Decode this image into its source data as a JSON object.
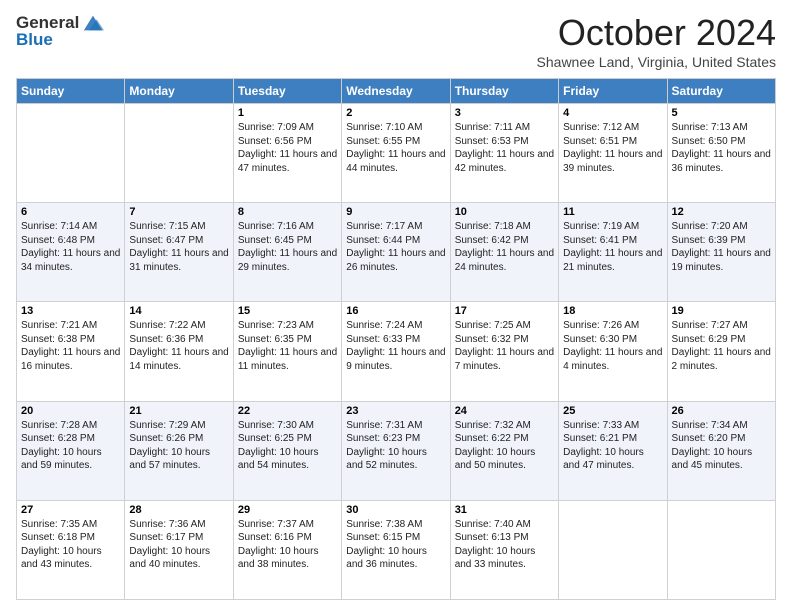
{
  "header": {
    "logo_general": "General",
    "logo_blue": "Blue",
    "month_title": "October 2024",
    "location": "Shawnee Land, Virginia, United States"
  },
  "days_of_week": [
    "Sunday",
    "Monday",
    "Tuesday",
    "Wednesday",
    "Thursday",
    "Friday",
    "Saturday"
  ],
  "weeks": [
    [
      {
        "day": "",
        "sunrise": "",
        "sunset": "",
        "daylight": ""
      },
      {
        "day": "",
        "sunrise": "",
        "sunset": "",
        "daylight": ""
      },
      {
        "day": "1",
        "sunrise": "Sunrise: 7:09 AM",
        "sunset": "Sunset: 6:56 PM",
        "daylight": "Daylight: 11 hours and 47 minutes."
      },
      {
        "day": "2",
        "sunrise": "Sunrise: 7:10 AM",
        "sunset": "Sunset: 6:55 PM",
        "daylight": "Daylight: 11 hours and 44 minutes."
      },
      {
        "day": "3",
        "sunrise": "Sunrise: 7:11 AM",
        "sunset": "Sunset: 6:53 PM",
        "daylight": "Daylight: 11 hours and 42 minutes."
      },
      {
        "day": "4",
        "sunrise": "Sunrise: 7:12 AM",
        "sunset": "Sunset: 6:51 PM",
        "daylight": "Daylight: 11 hours and 39 minutes."
      },
      {
        "day": "5",
        "sunrise": "Sunrise: 7:13 AM",
        "sunset": "Sunset: 6:50 PM",
        "daylight": "Daylight: 11 hours and 36 minutes."
      }
    ],
    [
      {
        "day": "6",
        "sunrise": "Sunrise: 7:14 AM",
        "sunset": "Sunset: 6:48 PM",
        "daylight": "Daylight: 11 hours and 34 minutes."
      },
      {
        "day": "7",
        "sunrise": "Sunrise: 7:15 AM",
        "sunset": "Sunset: 6:47 PM",
        "daylight": "Daylight: 11 hours and 31 minutes."
      },
      {
        "day": "8",
        "sunrise": "Sunrise: 7:16 AM",
        "sunset": "Sunset: 6:45 PM",
        "daylight": "Daylight: 11 hours and 29 minutes."
      },
      {
        "day": "9",
        "sunrise": "Sunrise: 7:17 AM",
        "sunset": "Sunset: 6:44 PM",
        "daylight": "Daylight: 11 hours and 26 minutes."
      },
      {
        "day": "10",
        "sunrise": "Sunrise: 7:18 AM",
        "sunset": "Sunset: 6:42 PM",
        "daylight": "Daylight: 11 hours and 24 minutes."
      },
      {
        "day": "11",
        "sunrise": "Sunrise: 7:19 AM",
        "sunset": "Sunset: 6:41 PM",
        "daylight": "Daylight: 11 hours and 21 minutes."
      },
      {
        "day": "12",
        "sunrise": "Sunrise: 7:20 AM",
        "sunset": "Sunset: 6:39 PM",
        "daylight": "Daylight: 11 hours and 19 minutes."
      }
    ],
    [
      {
        "day": "13",
        "sunrise": "Sunrise: 7:21 AM",
        "sunset": "Sunset: 6:38 PM",
        "daylight": "Daylight: 11 hours and 16 minutes."
      },
      {
        "day": "14",
        "sunrise": "Sunrise: 7:22 AM",
        "sunset": "Sunset: 6:36 PM",
        "daylight": "Daylight: 11 hours and 14 minutes."
      },
      {
        "day": "15",
        "sunrise": "Sunrise: 7:23 AM",
        "sunset": "Sunset: 6:35 PM",
        "daylight": "Daylight: 11 hours and 11 minutes."
      },
      {
        "day": "16",
        "sunrise": "Sunrise: 7:24 AM",
        "sunset": "Sunset: 6:33 PM",
        "daylight": "Daylight: 11 hours and 9 minutes."
      },
      {
        "day": "17",
        "sunrise": "Sunrise: 7:25 AM",
        "sunset": "Sunset: 6:32 PM",
        "daylight": "Daylight: 11 hours and 7 minutes."
      },
      {
        "day": "18",
        "sunrise": "Sunrise: 7:26 AM",
        "sunset": "Sunset: 6:30 PM",
        "daylight": "Daylight: 11 hours and 4 minutes."
      },
      {
        "day": "19",
        "sunrise": "Sunrise: 7:27 AM",
        "sunset": "Sunset: 6:29 PM",
        "daylight": "Daylight: 11 hours and 2 minutes."
      }
    ],
    [
      {
        "day": "20",
        "sunrise": "Sunrise: 7:28 AM",
        "sunset": "Sunset: 6:28 PM",
        "daylight": "Daylight: 10 hours and 59 minutes."
      },
      {
        "day": "21",
        "sunrise": "Sunrise: 7:29 AM",
        "sunset": "Sunset: 6:26 PM",
        "daylight": "Daylight: 10 hours and 57 minutes."
      },
      {
        "day": "22",
        "sunrise": "Sunrise: 7:30 AM",
        "sunset": "Sunset: 6:25 PM",
        "daylight": "Daylight: 10 hours and 54 minutes."
      },
      {
        "day": "23",
        "sunrise": "Sunrise: 7:31 AM",
        "sunset": "Sunset: 6:23 PM",
        "daylight": "Daylight: 10 hours and 52 minutes."
      },
      {
        "day": "24",
        "sunrise": "Sunrise: 7:32 AM",
        "sunset": "Sunset: 6:22 PM",
        "daylight": "Daylight: 10 hours and 50 minutes."
      },
      {
        "day": "25",
        "sunrise": "Sunrise: 7:33 AM",
        "sunset": "Sunset: 6:21 PM",
        "daylight": "Daylight: 10 hours and 47 minutes."
      },
      {
        "day": "26",
        "sunrise": "Sunrise: 7:34 AM",
        "sunset": "Sunset: 6:20 PM",
        "daylight": "Daylight: 10 hours and 45 minutes."
      }
    ],
    [
      {
        "day": "27",
        "sunrise": "Sunrise: 7:35 AM",
        "sunset": "Sunset: 6:18 PM",
        "daylight": "Daylight: 10 hours and 43 minutes."
      },
      {
        "day": "28",
        "sunrise": "Sunrise: 7:36 AM",
        "sunset": "Sunset: 6:17 PM",
        "daylight": "Daylight: 10 hours and 40 minutes."
      },
      {
        "day": "29",
        "sunrise": "Sunrise: 7:37 AM",
        "sunset": "Sunset: 6:16 PM",
        "daylight": "Daylight: 10 hours and 38 minutes."
      },
      {
        "day": "30",
        "sunrise": "Sunrise: 7:38 AM",
        "sunset": "Sunset: 6:15 PM",
        "daylight": "Daylight: 10 hours and 36 minutes."
      },
      {
        "day": "31",
        "sunrise": "Sunrise: 7:40 AM",
        "sunset": "Sunset: 6:13 PM",
        "daylight": "Daylight: 10 hours and 33 minutes."
      },
      {
        "day": "",
        "sunrise": "",
        "sunset": "",
        "daylight": ""
      },
      {
        "day": "",
        "sunrise": "",
        "sunset": "",
        "daylight": ""
      }
    ]
  ]
}
